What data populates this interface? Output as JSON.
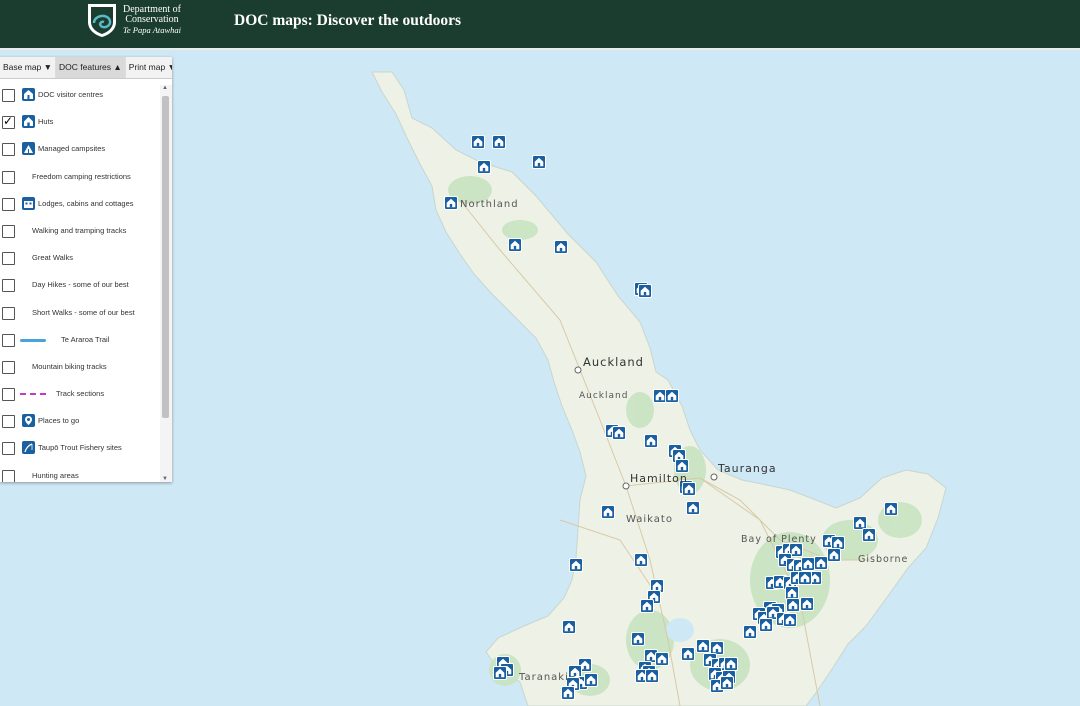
{
  "header": {
    "org_line1": "Department of",
    "org_line2": "Conservation",
    "org_line3": "Te Papa Atawhai",
    "title": "DOC maps: Discover the outdoors",
    "bg_color": "#1b3d2f"
  },
  "panel": {
    "tabs": [
      {
        "label": "Base map ▼"
      },
      {
        "label": "DOC features ▲",
        "active": true
      },
      {
        "label": "Print map ▼"
      }
    ],
    "layers": [
      {
        "label": "DOC visitor centres",
        "checked": false,
        "icon": "visitor-centre-icon"
      },
      {
        "label": "Huts",
        "checked": true,
        "icon": "hut-icon"
      },
      {
        "label": "Managed campsites",
        "checked": false,
        "icon": "campsite-icon"
      },
      {
        "label": "Freedom camping restrictions",
        "checked": false,
        "icon": ""
      },
      {
        "label": "Lodges, cabins and cottages",
        "checked": false,
        "icon": "lodge-icon"
      },
      {
        "label": "Walking and tramping tracks",
        "checked": false,
        "icon": ""
      },
      {
        "label": "Great Walks",
        "checked": false,
        "icon": ""
      },
      {
        "label": "Day Hikes - some of our best",
        "checked": false,
        "icon": ""
      },
      {
        "label": "Short Walks - some of our best",
        "checked": false,
        "icon": ""
      },
      {
        "label": "Te Araroa Trail",
        "checked": false,
        "icon": "solid-line"
      },
      {
        "label": "Mountain biking tracks",
        "checked": false,
        "icon": ""
      },
      {
        "label": "Track sections",
        "checked": false,
        "icon": "dashed-line"
      },
      {
        "label": "Places to go",
        "checked": false,
        "icon": "place-pin-icon"
      },
      {
        "label": "Taupō Trout Fishery sites",
        "checked": false,
        "icon": "fishery-icon"
      },
      {
        "label": "Hunting areas",
        "checked": false,
        "icon": ""
      }
    ]
  },
  "map": {
    "labels": {
      "northland": "Northland",
      "auckland_city": "Auckland",
      "auckland_region": "Auckland",
      "tauranga": "Tauranga",
      "hamilton": "Hamilton",
      "waikato": "Waikato",
      "bay_of_plenty": "Bay of Plenty",
      "gisborne": "Gisborne",
      "taranaki": "Taranaki"
    },
    "colors": {
      "sea": "#cfe8f5",
      "land": "#eef2e6",
      "park": "#c8e3c0",
      "marker": "#1a5fa0"
    }
  }
}
